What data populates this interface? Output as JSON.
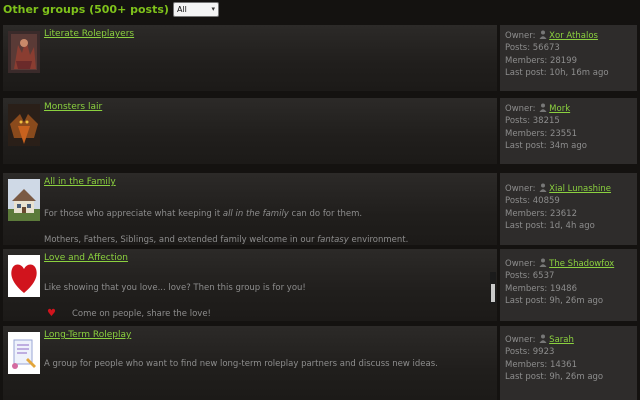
{
  "header": {
    "title": "Other groups (500+ posts)",
    "filter_value": "All"
  },
  "groups": [
    {
      "name": "Literate Roleplayers",
      "owner_label": "Owner:",
      "owner": "Xor Athalos",
      "posts": "Posts: 56673",
      "members": "Members: 28199",
      "last_post": "Last post: 10h, 16m ago"
    },
    {
      "name": "Monsters lair",
      "owner_label": "Owner:",
      "owner": "Mork",
      "posts": "Posts: 38215",
      "members": "Members: 23551",
      "last_post": "Last post: 34m ago"
    },
    {
      "name": "All in the Family",
      "desc1_pre": "For those who appreciate what keeping it ",
      "desc1_em": "all in the family",
      "desc1_post": " can do for them.",
      "desc2_pre": "Mothers, Fathers, Siblings, and extended family welcome in our ",
      "desc2_em": "fantasy",
      "desc2_post": " environment.",
      "owner_label": "Owner:",
      "owner": "Xial Lunashine",
      "posts": "Posts: 40859",
      "members": "Members: 23612",
      "last_post": "Last post: 1d, 4h ago"
    },
    {
      "name": "Love and Affection",
      "desc1": "Like showing that you love... love? Then this group is for you!",
      "desc2": "Come on people, share the love!",
      "owner_label": "Owner:",
      "owner": "The Shadowfox",
      "posts": "Posts: 6537",
      "members": "Members: 19486",
      "last_post": "Last post: 9h, 26m ago"
    },
    {
      "name": "Long-Term Roleplay",
      "desc1": "A group for people who want to find new long-term roleplay partners and discuss new ideas.",
      "owner_label": "Owner:",
      "owner": "Sarah",
      "posts": "Posts: 9923",
      "members": "Members: 14361",
      "last_post": "Last post: 9h, 26m ago"
    }
  ],
  "colors": {
    "accent_green": "#7fc21b",
    "link_green": "#8bd13f",
    "heart_red": "#d1141d"
  },
  "icons": {
    "user": "user-icon",
    "heart": "heart-icon",
    "select_arrow": "chevron-down-icon"
  }
}
